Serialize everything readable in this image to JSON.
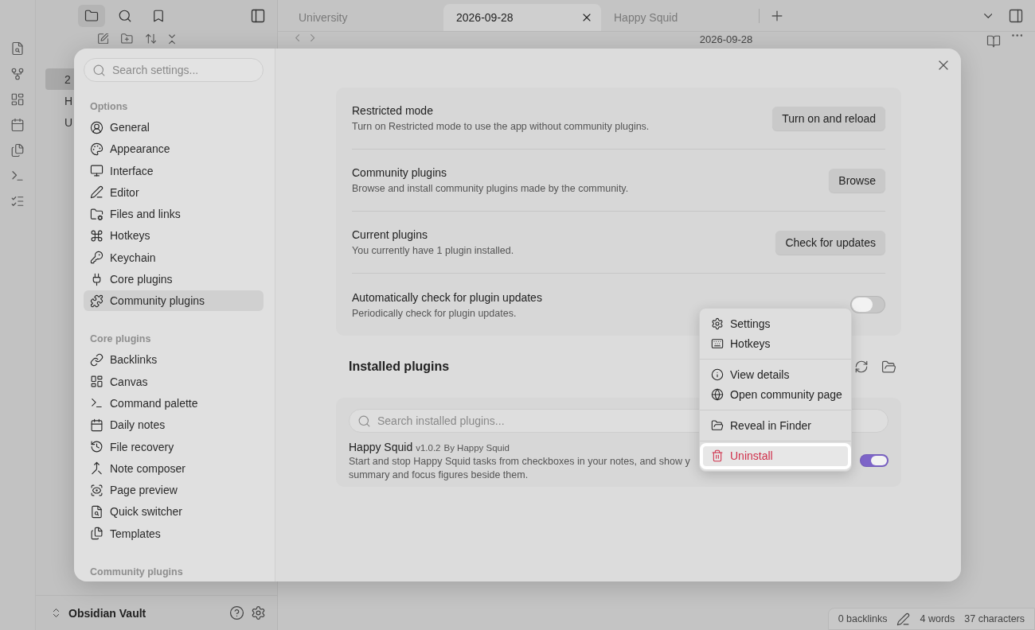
{
  "left_tabs": [
    {
      "kind": "files",
      "selected": true
    },
    {
      "kind": "search",
      "selected": false
    },
    {
      "kind": "bookmarks",
      "selected": false
    }
  ],
  "file_list": [
    {
      "label": "2",
      "selected": true
    },
    {
      "label": "H",
      "selected": false
    },
    {
      "label": "U",
      "selected": false
    }
  ],
  "tabs": [
    {
      "label": "University",
      "selected": false
    },
    {
      "label": "2026-09-28",
      "selected": true
    },
    {
      "label": "Happy Squid",
      "selected": false
    }
  ],
  "note_title": "2026-09-28",
  "vault": {
    "name": "Obsidian Vault"
  },
  "status_bar": {
    "backlinks": "0 backlinks",
    "words": "4 words",
    "characters": "37 characters"
  },
  "settings": {
    "search_placeholder": "Search settings...",
    "groups": [
      {
        "heading": "Options",
        "items": [
          {
            "label": "General",
            "kind": "general",
            "selected": false
          },
          {
            "label": "Appearance",
            "kind": "appearance",
            "selected": false
          },
          {
            "label": "Interface",
            "kind": "interface",
            "selected": false
          },
          {
            "label": "Editor",
            "kind": "editor",
            "selected": false
          },
          {
            "label": "Files and links",
            "kind": "files",
            "selected": false
          },
          {
            "label": "Hotkeys",
            "kind": "hotkeys",
            "selected": false
          },
          {
            "label": "Keychain",
            "kind": "keychain",
            "selected": false
          },
          {
            "label": "Core plugins",
            "kind": "core",
            "selected": false
          },
          {
            "label": "Community plugins",
            "kind": "community",
            "selected": true
          }
        ]
      },
      {
        "heading": "Core plugins",
        "items": [
          {
            "label": "Backlinks",
            "kind": "backlinks",
            "selected": false
          },
          {
            "label": "Canvas",
            "kind": "canvas",
            "selected": false
          },
          {
            "label": "Command palette",
            "kind": "command",
            "selected": false
          },
          {
            "label": "Daily notes",
            "kind": "daily",
            "selected": false
          },
          {
            "label": "File recovery",
            "kind": "recovery",
            "selected": false
          },
          {
            "label": "Note composer",
            "kind": "composer",
            "selected": false
          },
          {
            "label": "Page preview",
            "kind": "preview",
            "selected": false
          },
          {
            "label": "Quick switcher",
            "kind": "switcher",
            "selected": false
          },
          {
            "label": "Templates",
            "kind": "templates",
            "selected": false
          }
        ]
      },
      {
        "heading": "Community plugins"
      }
    ],
    "sections": [
      {
        "kind": "button",
        "title": "Restricted mode",
        "description": "Turn on Restricted mode to use the app without community plugins.",
        "button": "Turn on and reload"
      },
      {
        "kind": "button",
        "title": "Community plugins",
        "description": "Browse and install community plugins made by the community.",
        "button": "Browse"
      },
      {
        "kind": "button",
        "title": "Current plugins",
        "description": "You currently have 1 plugin installed.",
        "button": "Check for updates"
      },
      {
        "kind": "toggle",
        "title": "Automatically check for plugin updates",
        "description": "Periodically check for plugin updates.",
        "on": false
      }
    ],
    "installed": {
      "heading": "Installed plugins",
      "search_placeholder": "Search installed plugins...",
      "plugins": [
        {
          "name": "Happy Squid",
          "version": "v1.0.2",
          "author": "By Happy Squid",
          "description_lines": [
            "Start and stop Happy Squid tasks from checkboxes in your notes, and show y",
            "summary and focus figures beside them."
          ],
          "enabled": true
        }
      ]
    }
  },
  "context_menu": {
    "groups": [
      [
        {
          "label": "Settings",
          "kind": "settings",
          "selected": false,
          "danger": false
        },
        {
          "label": "Hotkeys",
          "kind": "hotkeys",
          "selected": false,
          "danger": false
        }
      ],
      [
        {
          "label": "View details",
          "kind": "details",
          "selected": false,
          "danger": false
        },
        {
          "label": "Open community page",
          "kind": "community",
          "selected": false,
          "danger": false
        }
      ],
      [
        {
          "label": "Reveal in Finder",
          "kind": "reveal",
          "selected": false,
          "danger": false
        }
      ],
      [
        {
          "label": "Uninstall",
          "kind": "uninstall",
          "selected": true,
          "danger": true
        }
      ]
    ]
  }
}
